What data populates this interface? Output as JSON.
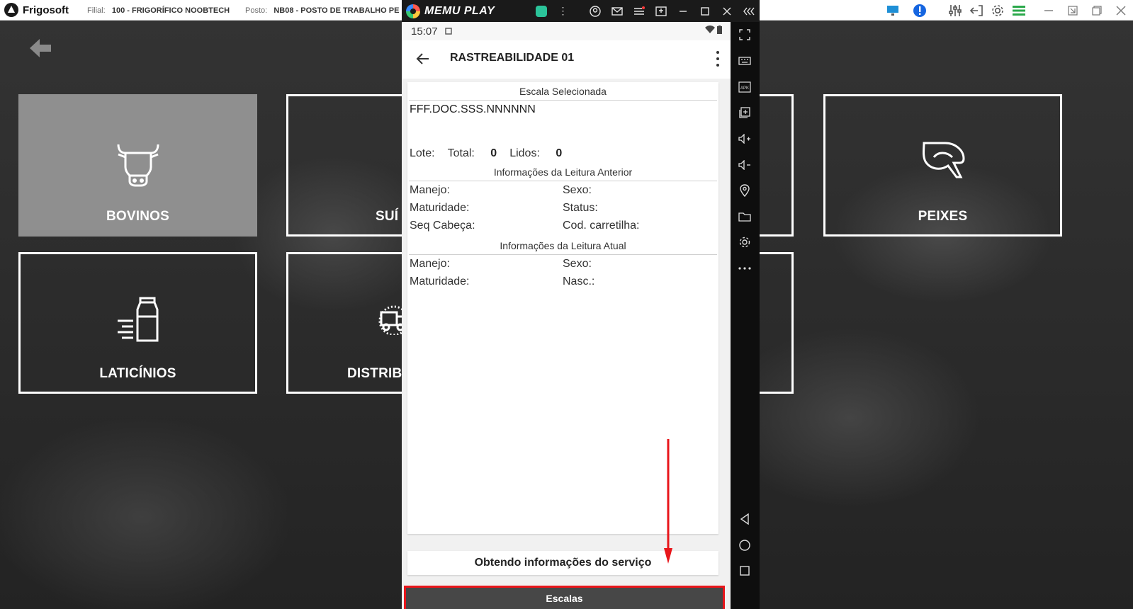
{
  "desktop": {
    "brand": "Frigosoft",
    "filial_label": "Filial:",
    "filial_value": "100 - FRIGORÍFICO NOOBTECH",
    "posto_label": "Posto:",
    "posto_value": "NB08 - POSTO DE TRABALHO PE",
    "tiles": [
      {
        "label": "BOVINOS",
        "icon": "cow-icon",
        "active": true
      },
      {
        "label": "SUÍ",
        "icon": "pig-icon",
        "active": false
      },
      {
        "label": "PEIXES",
        "icon": "fish-icon",
        "active": false
      },
      {
        "label": "LATICÍNIOS",
        "icon": "milk-bottle-icon",
        "active": false
      },
      {
        "label": "DISTRIB",
        "icon": "truck-icon",
        "active": false
      }
    ]
  },
  "emulator": {
    "name": "MEMU PLAY",
    "status_time": "15:07",
    "app_title": "RASTREABILIDADE 01",
    "escala_title": "Escala Selecionada",
    "escala_value": "FFF.DOC.SSS.NNNNNN",
    "lote_label": "Lote:",
    "total_label": "Total:",
    "total_value": "0",
    "lidos_label": "Lidos:",
    "lidos_value": "0",
    "anterior_title": "Informações da Leitura Anterior",
    "anterior": {
      "manejo": "Manejo:",
      "sexo": "Sexo:",
      "maturidade": "Maturidade:",
      "status": "Status:",
      "seq_cabeca": "Seq Cabeça:",
      "cod_carretilha": "Cod. carretilha:"
    },
    "atual_title": "Informações da Leitura Atual",
    "atual": {
      "manejo": "Manejo:",
      "sexo": "Sexo:",
      "maturidade": "Maturidade:",
      "nasc": "Nasc.:"
    },
    "message": "Obtendo informações do serviço",
    "escalas_button": "Escalas"
  },
  "colors": {
    "active_tile": "#8f8f8f",
    "highlight": "#e8161b",
    "escalas_bg": "#474747",
    "accent_green": "#2bc49a"
  }
}
